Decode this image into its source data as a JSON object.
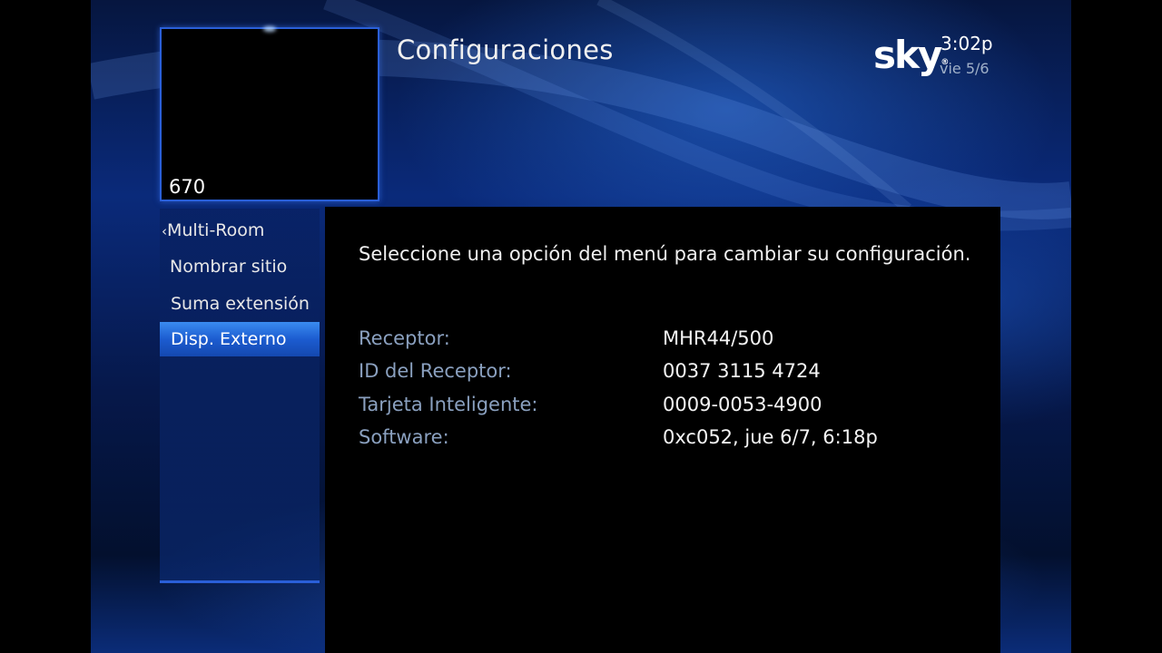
{
  "header": {
    "title": "Configuraciones",
    "brand": "sky",
    "time": "3:02p",
    "date": "vie 5/6"
  },
  "preview": {
    "channel_number": "670"
  },
  "sidebar": {
    "items": [
      {
        "label": "Multi-Room",
        "prefix": "‹"
      },
      {
        "label": "Nombrar sitio"
      },
      {
        "label": "Suma extensión"
      },
      {
        "label": "Disp. Externo",
        "selected": true
      }
    ]
  },
  "main": {
    "instruction": "Seleccione una opción del menú para cambiar su configuración.",
    "info": [
      {
        "label": "Receptor:",
        "value": "MHR44/500"
      },
      {
        "label": "ID del Receptor:",
        "value": "0037 3115 4724"
      },
      {
        "label": "Tarjeta Inteligente:",
        "value": "0009-0053-4900"
      },
      {
        "label": "Software:",
        "value": "0xc052, jue 6/7, 6:18p"
      }
    ]
  },
  "colors": {
    "accent": "#2a5fd8",
    "selected": "#1c5cd0",
    "label": "#8aa0bf"
  }
}
